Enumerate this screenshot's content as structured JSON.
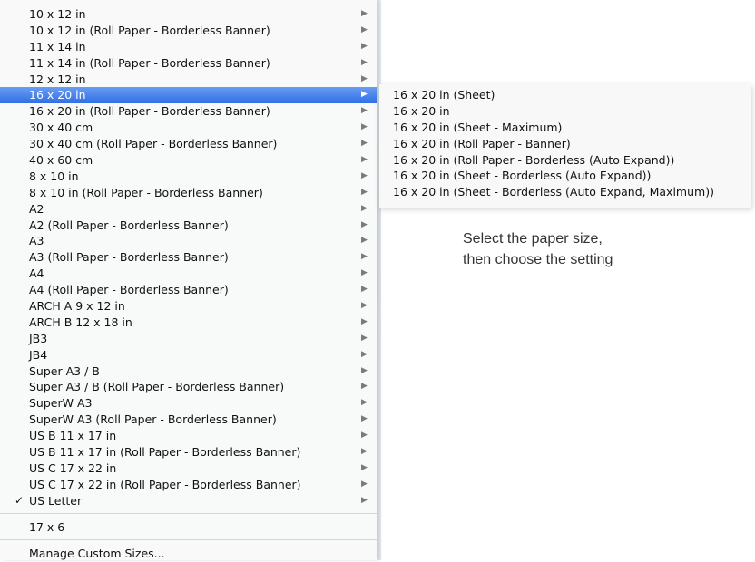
{
  "menu": {
    "items": [
      {
        "label": "10 x 12 in",
        "has_submenu": true
      },
      {
        "label": "10 x 12 in (Roll Paper - Borderless Banner)",
        "has_submenu": true
      },
      {
        "label": "11 x 14 in",
        "has_submenu": true
      },
      {
        "label": "11 x 14 in (Roll Paper - Borderless Banner)",
        "has_submenu": true
      },
      {
        "label": "12 x 12 in",
        "has_submenu": true
      },
      {
        "label": "16 x 20 in",
        "has_submenu": true,
        "highlighted": true
      },
      {
        "label": "16 x 20 in (Roll Paper - Borderless Banner)",
        "has_submenu": true
      },
      {
        "label": "30 x 40 cm",
        "has_submenu": true
      },
      {
        "label": "30 x 40 cm (Roll Paper - Borderless Banner)",
        "has_submenu": true
      },
      {
        "label": "40 x 60 cm",
        "has_submenu": true
      },
      {
        "label": "8 x 10 in",
        "has_submenu": true
      },
      {
        "label": "8 x 10 in (Roll Paper - Borderless Banner)",
        "has_submenu": true
      },
      {
        "label": "A2",
        "has_submenu": true
      },
      {
        "label": "A2 (Roll Paper - Borderless Banner)",
        "has_submenu": true
      },
      {
        "label": "A3",
        "has_submenu": true
      },
      {
        "label": "A3 (Roll Paper - Borderless Banner)",
        "has_submenu": true
      },
      {
        "label": "A4",
        "has_submenu": true
      },
      {
        "label": "A4 (Roll Paper - Borderless Banner)",
        "has_submenu": true
      },
      {
        "label": "ARCH A 9 x 12 in",
        "has_submenu": true
      },
      {
        "label": "ARCH B 12 x 18 in",
        "has_submenu": true
      },
      {
        "label": "JB3",
        "has_submenu": true
      },
      {
        "label": "JB4",
        "has_submenu": true
      },
      {
        "label": "Super A3 / B",
        "has_submenu": true
      },
      {
        "label": "Super A3 / B (Roll Paper - Borderless Banner)",
        "has_submenu": true
      },
      {
        "label": "SuperW A3",
        "has_submenu": true
      },
      {
        "label": "SuperW A3 (Roll Paper - Borderless Banner)",
        "has_submenu": true
      },
      {
        "label": "US B 11 x 17 in",
        "has_submenu": true
      },
      {
        "label": "US B 11 x 17 in (Roll Paper - Borderless Banner)",
        "has_submenu": true
      },
      {
        "label": "US C 17 x 22 in",
        "has_submenu": true
      },
      {
        "label": "US C 17 x 22 in (Roll Paper - Borderless Banner)",
        "has_submenu": true
      },
      {
        "label": "US Letter",
        "has_submenu": true,
        "checked": true,
        "check_mark": "✓"
      }
    ],
    "extra_items": [
      {
        "label": "17 x 6"
      },
      {
        "label": "Manage Custom Sizes..."
      }
    ],
    "arrow_icon": "▶",
    "highlight_color": "#2f6fe6"
  },
  "submenu": {
    "items": [
      "16 x 20 in (Sheet)",
      "16 x 20 in",
      "16 x 20 in (Sheet - Maximum)",
      "16 x 20 in (Roll Paper - Banner)",
      "16 x 20 in (Roll Paper - Borderless (Auto Expand))",
      "16 x 20 in (Sheet - Borderless (Auto Expand))",
      "16 x 20 in (Sheet - Borderless (Auto Expand, Maximum))"
    ]
  },
  "caption": {
    "line1": "Select the paper size,",
    "line2": "then choose the setting"
  }
}
